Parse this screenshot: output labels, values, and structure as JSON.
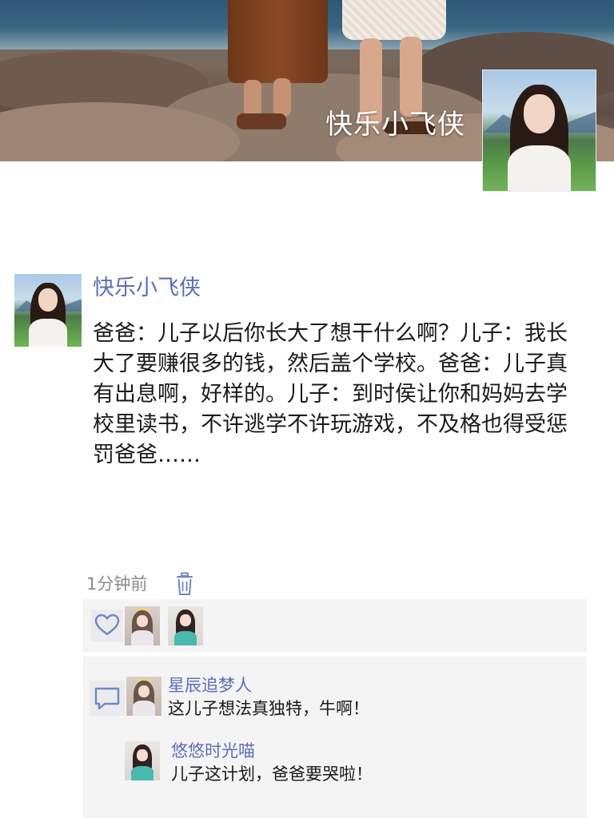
{
  "profile": {
    "name": "快乐小飞侠"
  },
  "post": {
    "author": "快乐小飞侠",
    "text": "爸爸：儿子以后你长大了想干什么啊？儿子：我长大了要赚很多的钱，然后盖个学校。爸爸：儿子真有出息啊，好样的。儿子：到时侯让你和妈妈去学校里读书，不许逃学不许玩游戏，不及格也得受惩罚爸爸……",
    "time": "1分钟前"
  },
  "likes": {
    "icon": "heart-outline-icon",
    "count_avatars": 2
  },
  "comments": [
    {
      "author": "星辰追梦人",
      "text": "这儿子想法真独特，牛啊！"
    },
    {
      "author": "悠悠时光喵",
      "text": "儿子这计划，爸爸要哭啦！"
    }
  ],
  "colors": {
    "link_blue": "#5b6fb5",
    "panel_bg": "#f4f4f5",
    "time_gray": "#8b8b8b"
  }
}
